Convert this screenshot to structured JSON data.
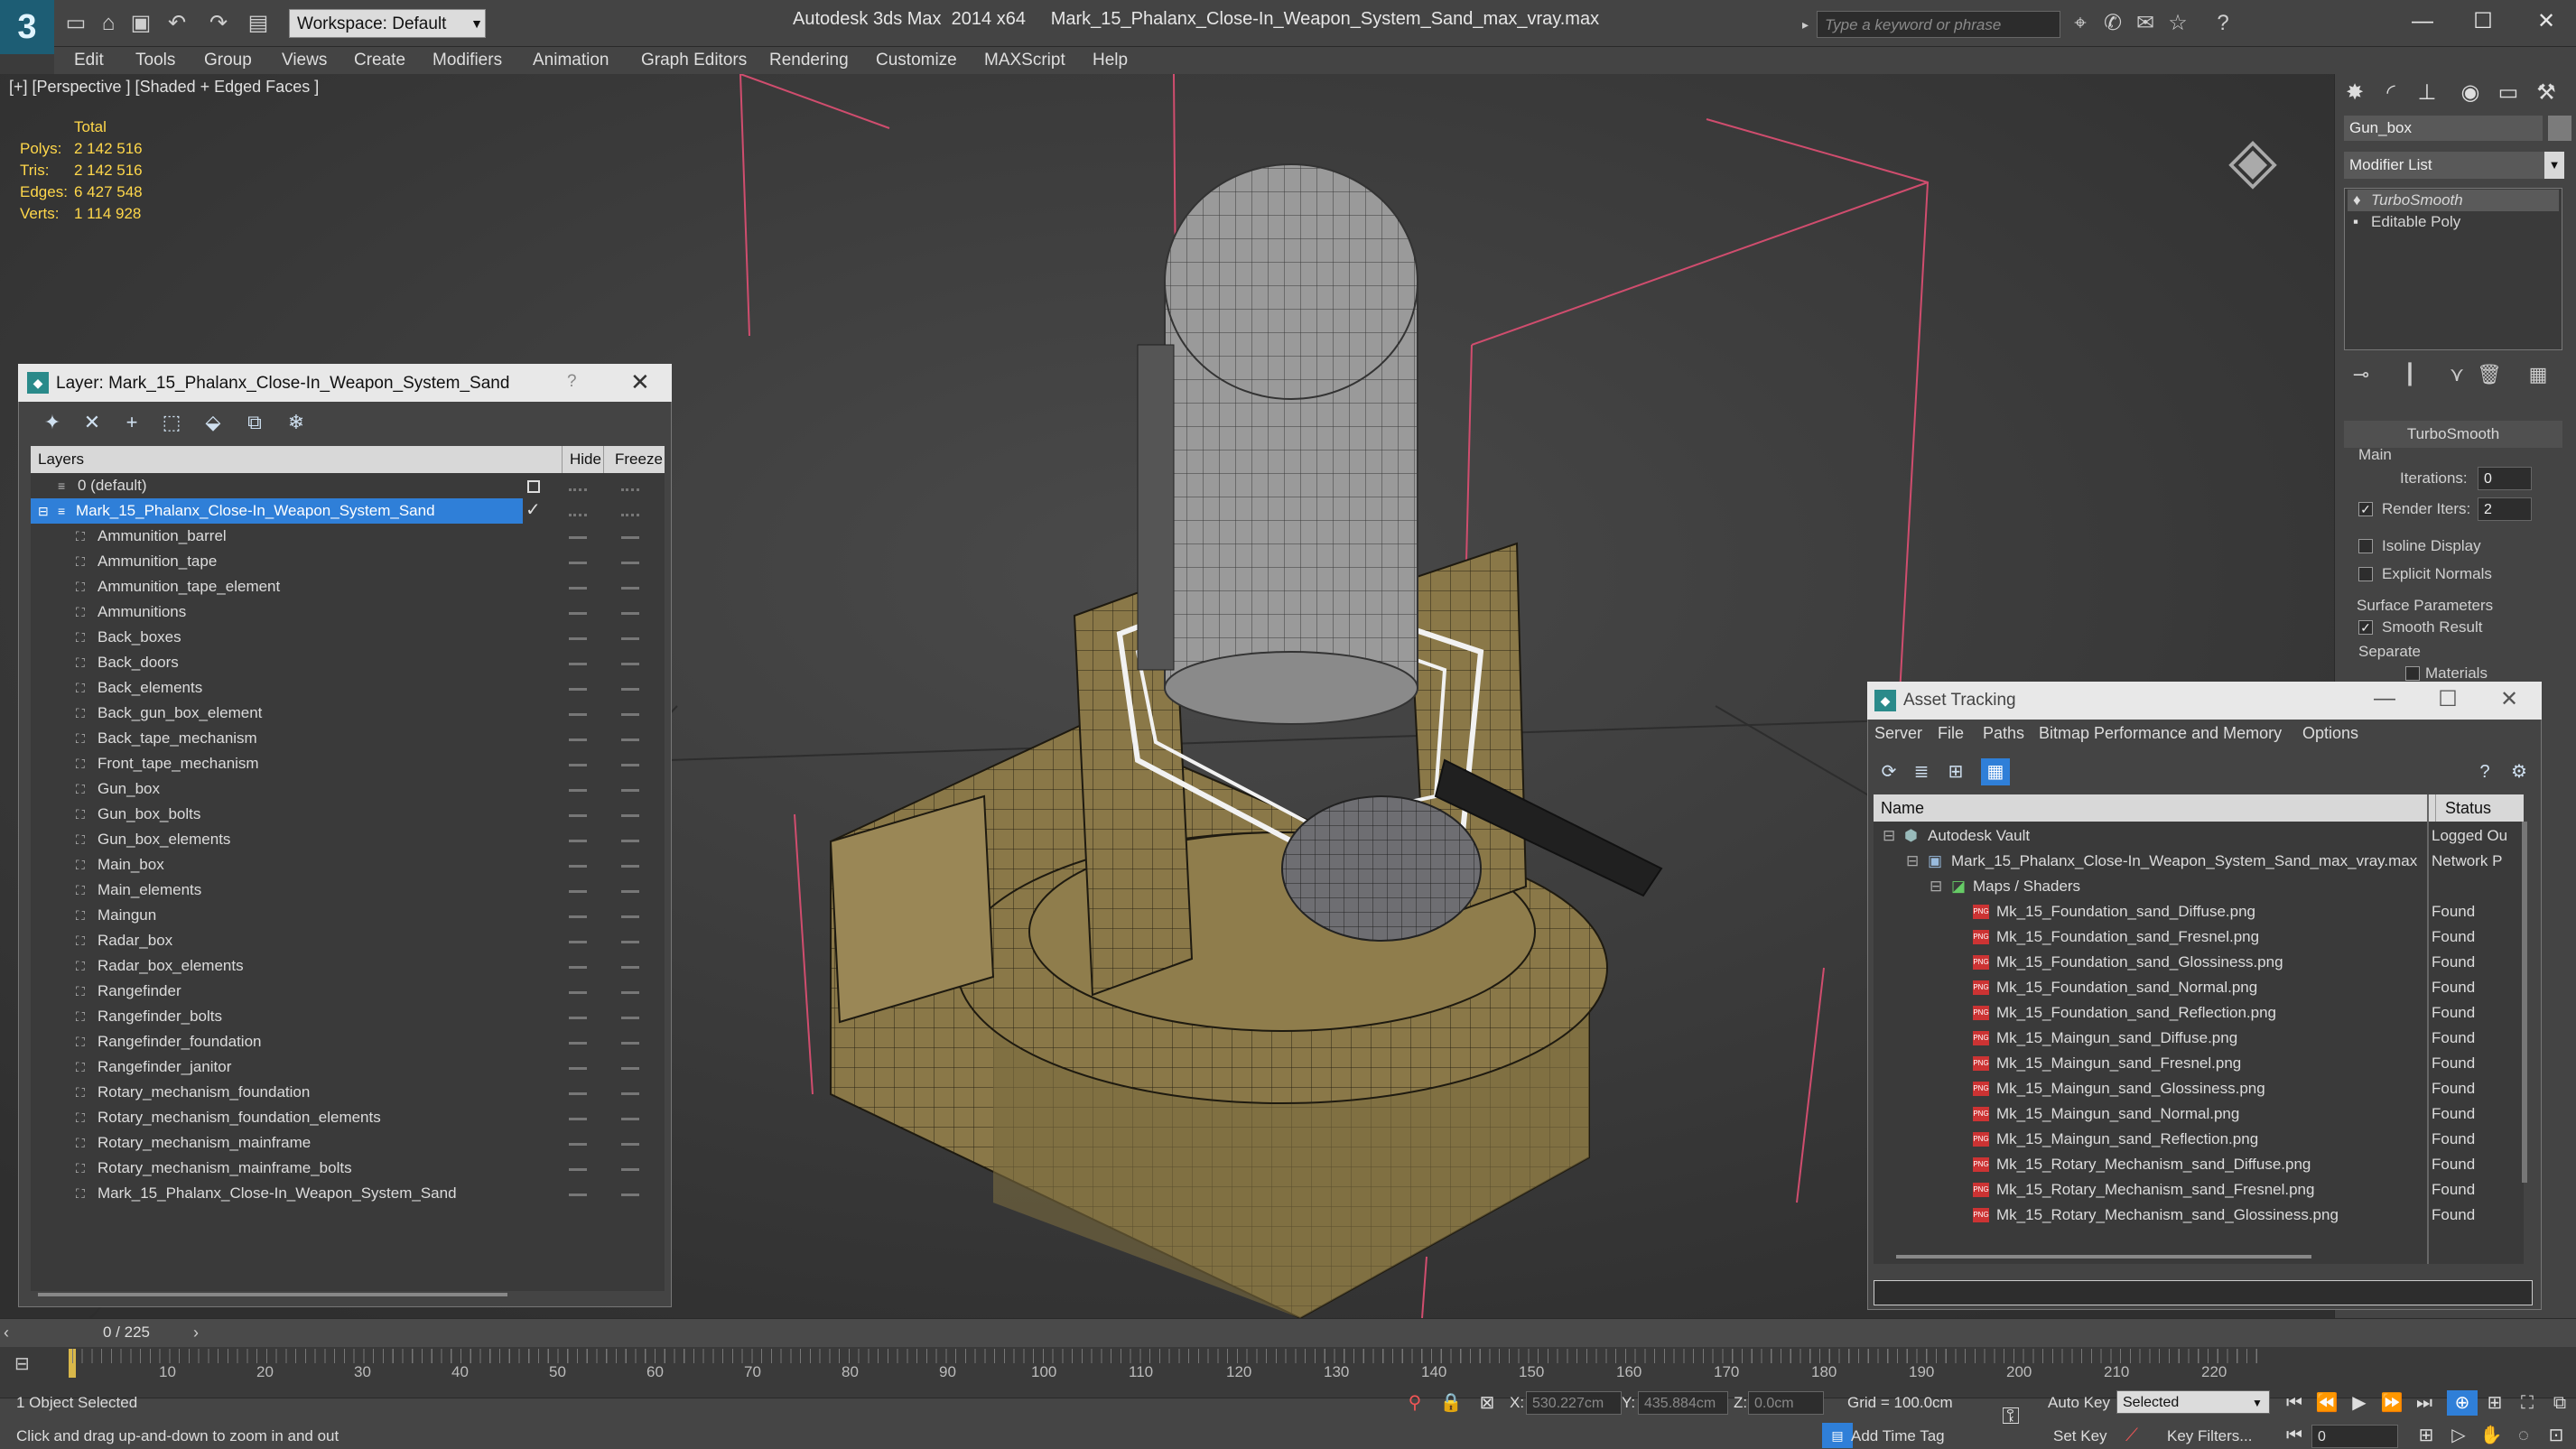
{
  "titlebar": {
    "title": "Autodesk 3ds Max  2014 x64     Mark_15_Phalanx_Close-In_Weapon_System_Sand_max_vray.max",
    "workspace": "Workspace: Default",
    "search_placeholder": "Type a keyword or phrase",
    "app_logo": "3"
  },
  "menubar": [
    "Edit",
    "Tools",
    "Group",
    "Views",
    "Create",
    "Modifiers",
    "Animation",
    "Graph Editors",
    "Rendering",
    "Customize",
    "MAXScript",
    "Help"
  ],
  "viewport": {
    "label": "[+] [Perspective ] [Shaded + Edged Faces ]",
    "stats": {
      "header": "Total",
      "rows": [
        {
          "label": "Polys:",
          "value": "2 142 516"
        },
        {
          "label": "Tris:",
          "value": "2 142 516"
        },
        {
          "label": "Edges:",
          "value": "6 427 548"
        },
        {
          "label": "Verts:",
          "value": "1 114 928"
        }
      ]
    }
  },
  "layer_dialog": {
    "title": "Layer: Mark_15_Phalanx_Close-In_Weapon_System_Sand",
    "help": "?",
    "close": "✕",
    "columns": {
      "layers": "Layers",
      "hide": "Hide",
      "freeze": "Freeze"
    },
    "default_layer": "0 (default)",
    "active_layer": "Mark_15_Phalanx_Close-In_Weapon_System_Sand",
    "objects": [
      "Ammunition_barrel",
      "Ammunition_tape",
      "Ammunition_tape_element",
      "Ammunitions",
      "Back_boxes",
      "Back_doors",
      "Back_elements",
      "Back_gun_box_element",
      "Back_tape_mechanism",
      "Front_tape_mechanism",
      "Gun_box",
      "Gun_box_bolts",
      "Gun_box_elements",
      "Main_box",
      "Main_elements",
      "Maingun",
      "Radar_box",
      "Radar_box_elements",
      "Rangefinder",
      "Rangefinder_bolts",
      "Rangefinder_foundation",
      "Rangefinder_janitor",
      "Rotary_mechanism_foundation",
      "Rotary_mechanism_foundation_elements",
      "Rotary_mechanism_mainframe",
      "Rotary_mechanism_mainframe_bolts",
      "Mark_15_Phalanx_Close-In_Weapon_System_Sand"
    ]
  },
  "command_panel": {
    "object_name": "Gun_box",
    "modifier_list": "Modifier List",
    "stack": [
      "TurboSmooth",
      "Editable Poly"
    ],
    "rollout_title": "TurboSmooth",
    "main_label": "Main",
    "iterations_label": "Iterations:",
    "iterations_value": "0",
    "render_iters_label": "Render Iters:",
    "render_iters_value": "2",
    "isoline_label": "Isoline Display",
    "explicit_normals_label": "Explicit Normals",
    "surface_params_label": "Surface Parameters",
    "smooth_result_label": "Smooth Result",
    "separate_label": "Separate",
    "materials_label": "Materials"
  },
  "asset_tracking": {
    "title": "Asset Tracking",
    "menu": [
      "Server",
      "File",
      "Paths",
      "Bitmap Performance and Memory",
      "Options"
    ],
    "columns": {
      "name": "Name",
      "status": "Status"
    },
    "rows": [
      {
        "name": "Autodesk Vault",
        "status": "Logged Ou",
        "indent": 0,
        "icon": "vault"
      },
      {
        "name": "Mark_15_Phalanx_Close-In_Weapon_System_Sand_max_vray.max",
        "status": "Network P",
        "indent": 1,
        "icon": "max"
      },
      {
        "name": "Maps / Shaders",
        "status": "",
        "indent": 2,
        "icon": "maps"
      },
      {
        "name": "Mk_15_Foundation_sand_Diffuse.png",
        "status": "Found",
        "indent": 3,
        "icon": "png"
      },
      {
        "name": "Mk_15_Foundation_sand_Fresnel.png",
        "status": "Found",
        "indent": 3,
        "icon": "png"
      },
      {
        "name": "Mk_15_Foundation_sand_Glossiness.png",
        "status": "Found",
        "indent": 3,
        "icon": "png"
      },
      {
        "name": "Mk_15_Foundation_sand_Normal.png",
        "status": "Found",
        "indent": 3,
        "icon": "png"
      },
      {
        "name": "Mk_15_Foundation_sand_Reflection.png",
        "status": "Found",
        "indent": 3,
        "icon": "png"
      },
      {
        "name": "Mk_15_Maingun_sand_Diffuse.png",
        "status": "Found",
        "indent": 3,
        "icon": "png"
      },
      {
        "name": "Mk_15_Maingun_sand_Fresnel.png",
        "status": "Found",
        "indent": 3,
        "icon": "png"
      },
      {
        "name": "Mk_15_Maingun_sand_Glossiness.png",
        "status": "Found",
        "indent": 3,
        "icon": "png"
      },
      {
        "name": "Mk_15_Maingun_sand_Normal.png",
        "status": "Found",
        "indent": 3,
        "icon": "png"
      },
      {
        "name": "Mk_15_Maingun_sand_Reflection.png",
        "status": "Found",
        "indent": 3,
        "icon": "png"
      },
      {
        "name": "Mk_15_Rotary_Mechanism_sand_Diffuse.png",
        "status": "Found",
        "indent": 3,
        "icon": "png"
      },
      {
        "name": "Mk_15_Rotary_Mechanism_sand_Fresnel.png",
        "status": "Found",
        "indent": 3,
        "icon": "png"
      },
      {
        "name": "Mk_15_Rotary_Mechanism_sand_Glossiness.png",
        "status": "Found",
        "indent": 3,
        "icon": "png"
      }
    ]
  },
  "timeline": {
    "counter": "0 / 225",
    "ticks": [
      "10",
      "20",
      "30",
      "40",
      "50",
      "60",
      "70",
      "80",
      "90",
      "100",
      "110",
      "120",
      "130",
      "140",
      "150",
      "160",
      "170",
      "180",
      "190",
      "200",
      "210",
      "220"
    ]
  },
  "statusbar": {
    "selection": "1 Object Selected",
    "prompt": "Click and drag up-and-down to zoom in and out",
    "x_label": "X:",
    "x_value": "530.227cm",
    "y_label": "Y:",
    "y_value": "435.884cm",
    "z_label": "Z:",
    "z_value": "0.0cm",
    "grid": "Grid = 100.0cm",
    "auto_key": "Auto Key",
    "selected_dropdown": "Selected",
    "set_key": "Set Key",
    "key_filters": "Key Filters...",
    "add_time_tag": "Add Time Tag",
    "frame_value": "0"
  },
  "colors": {
    "accent": "#2f7fd8",
    "stat_yellow": "#ffd74a",
    "model_tan": "#8c7a4a",
    "dome_grey": "#9e9e9e",
    "light_gizmo": "#d04d6e"
  },
  "icons": {
    "undo": "undo-icon",
    "redo": "redo-icon",
    "save": "save-icon",
    "open": "open-icon",
    "new": "new-icon",
    "search": "search-icon",
    "viewcube": "viewcube-icon",
    "png": "png-file-icon"
  }
}
